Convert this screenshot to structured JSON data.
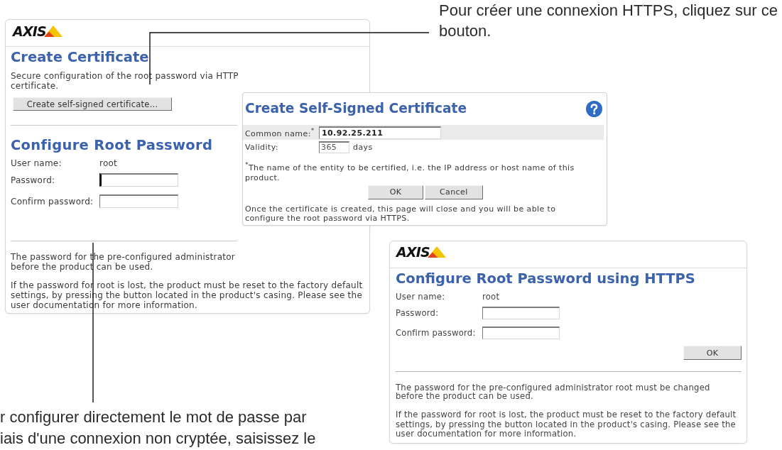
{
  "callouts": [
    {
      "text": "Pour créer une connexion HTTPS, cliquez sur ce\nbouton."
    },
    {
      "text": "r configurer directement le mot de passe par\niais d'une connexion non cryptée, saisissez le"
    }
  ],
  "setup_page": {
    "logo": "AXIS",
    "certificate_section": {
      "title": "Create Certificate",
      "description": "Secure configuration of the root password via HTTP\ncertificate.",
      "button": "Create self-signed certificate..."
    },
    "password_section": {
      "title": "Configure Root Password",
      "user_name": {
        "label": "User name:",
        "value": "root"
      },
      "fields": [
        {
          "label": "Password:",
          "focused": true
        },
        {
          "label": "Confirm password:",
          "focused": false
        }
      ]
    },
    "notes": [
      "The password for the pre-configured administrator\nbefore the product can be used.",
      "If the password for root is lost, the product must be reset to the factory default\nsettings, by pressing the button located in the product's casing. Please see the\nuser documentation for more information."
    ]
  },
  "certificate_dialog": {
    "title": "Create Self-Signed Certificate",
    "common_name": {
      "label": "Common name:$^{*}$",
      "value": "10.92.25.211"
    },
    "validity": {
      "label": "Validity:",
      "value": "365",
      "unit": "days"
    },
    "footnote": "$^{*}$The name of the entity to be certified, i.e. the IP address or host name of this\nproduct.",
    "buttons": [
      {
        "label": "OK"
      },
      {
        "label": "Cancel"
      }
    ],
    "note": "Once the certificate is created, this page will close and you will be able to\nconfigure the root password via HTTPS."
  },
  "https_page": {
    "logo": "AXIS",
    "title": "Configure Root Password using HTTPS",
    "user_name": {
      "label": "User name:",
      "value": "root"
    },
    "fields": [
      {
        "label": "Password:"
      },
      {
        "label": "Confirm password:"
      }
    ],
    "button": "OK",
    "notes": [
      "The password for the pre-configured administrator root must be changed\nbefore the product can be used.",
      "If the password for root is lost, the product must be reset to the factory default\nsettings, by pressing the button located in the product's casing. Please see the\nuser documentation for more information."
    ]
  }
}
